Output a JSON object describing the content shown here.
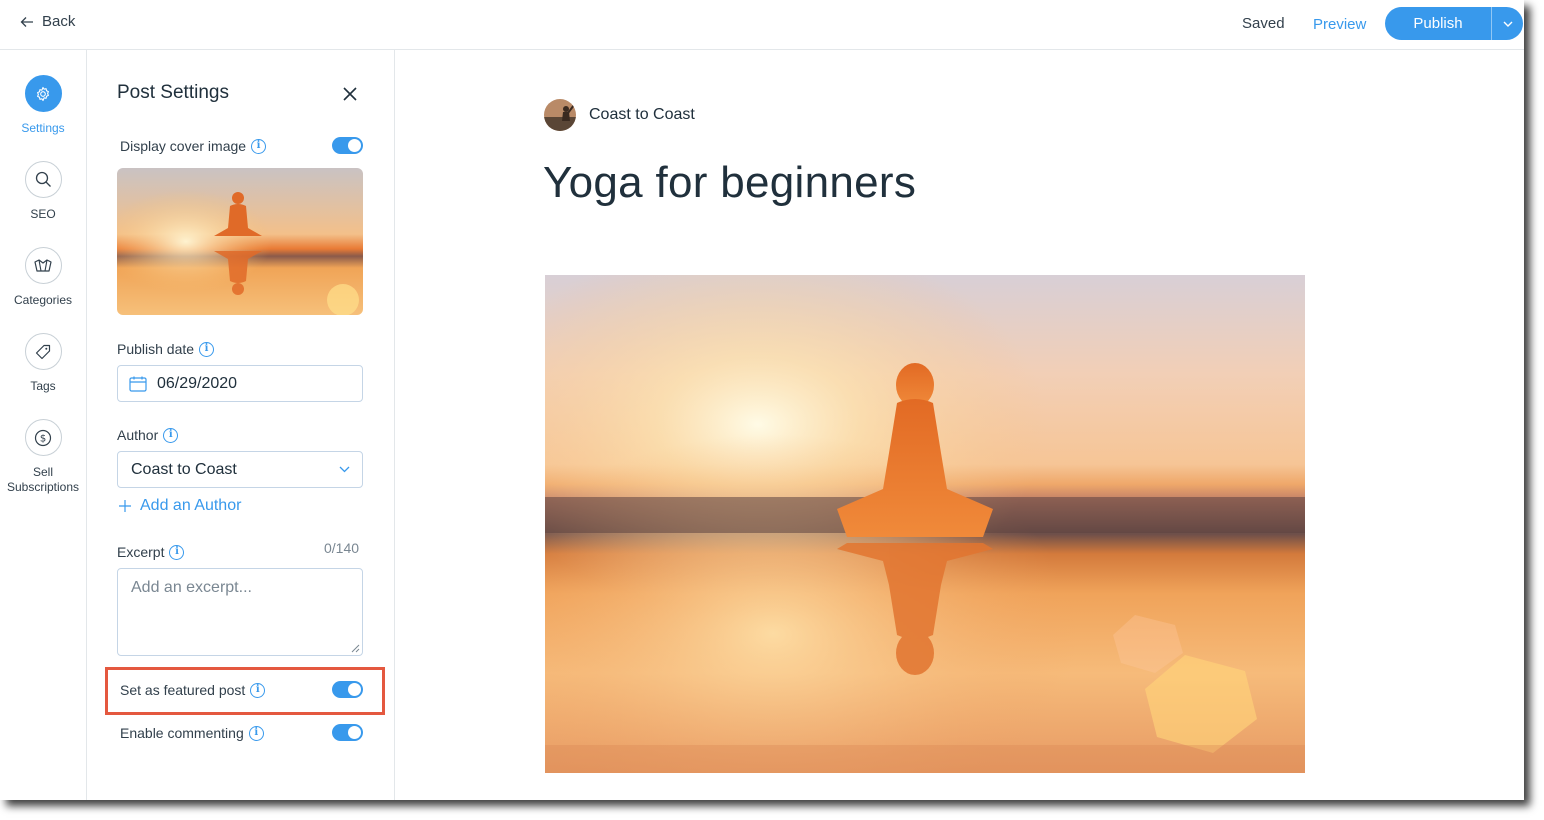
{
  "topbar": {
    "back_label": "Back",
    "saved_label": "Saved",
    "preview_label": "Preview",
    "publish_label": "Publish"
  },
  "sidebar": {
    "items": [
      {
        "label": "Settings",
        "icon": "gear-icon",
        "active": true
      },
      {
        "label": "SEO",
        "icon": "search-icon",
        "active": false
      },
      {
        "label": "Categories",
        "icon": "categories-icon",
        "active": false
      },
      {
        "label": "Tags",
        "icon": "tag-icon",
        "active": false
      },
      {
        "label": "Sell",
        "label2": "Subscriptions",
        "icon": "dollar-icon",
        "active": false
      }
    ]
  },
  "panel": {
    "title": "Post Settings",
    "display_cover_label": "Display cover image",
    "publish_date_label": "Publish date",
    "publish_date_value": "06/29/2020",
    "author_label": "Author",
    "author_value": "Coast to Coast",
    "add_author_label": "Add an Author",
    "excerpt_label": "Excerpt",
    "excerpt_counter": "0/140",
    "excerpt_placeholder": "Add an excerpt...",
    "featured_label": "Set as featured post",
    "commenting_label": "Enable commenting",
    "toggles": {
      "display_cover": true,
      "featured": true,
      "commenting": true
    }
  },
  "post": {
    "author_name": "Coast to Coast",
    "title": "Yoga for beginners"
  },
  "colors": {
    "accent": "#3899ec",
    "highlight": "#e4583f"
  }
}
